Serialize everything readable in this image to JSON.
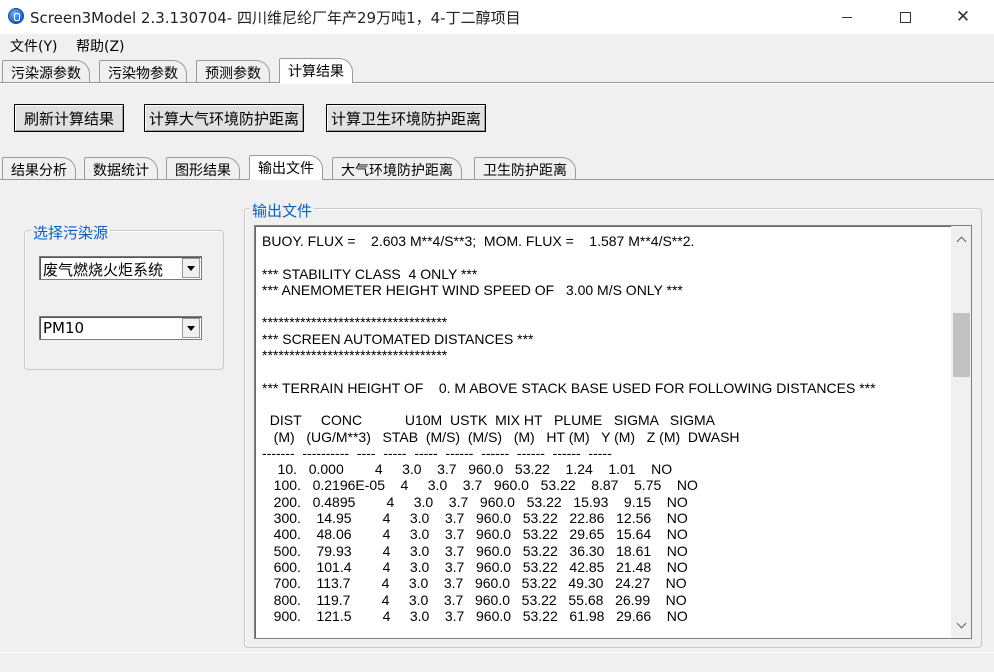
{
  "window": {
    "title": "Screen3Model 2.3.130704- 四川维尼纶厂年产29万吨1，4-丁二醇项目",
    "controls": {
      "minimize": "",
      "maximize": "",
      "close": "✕"
    }
  },
  "menu": {
    "file": "文件(Y)",
    "help": "帮助(Z)"
  },
  "top_tabs": [
    "污染源参数",
    "污染物参数",
    "预测参数",
    "计算结果"
  ],
  "top_tab_active": "计算结果",
  "buttons": {
    "refresh": "刷新计算结果",
    "air_distance": "计算大气环境防护距离",
    "health_distance": "计算卫生环境防护距离"
  },
  "sub_tabs": [
    "结果分析",
    "数据统计",
    "图形结果",
    "输出文件",
    "大气环境防护距离",
    "卫生防护距离"
  ],
  "sub_tab_active": "输出文件",
  "source_group": {
    "legend": "选择污染源",
    "source_select": "废气燃烧火炬系统",
    "pollutant_select": "PM10"
  },
  "output_group": {
    "legend": "输出文件",
    "lines": [
      "BUOY. FLUX =    2.603 M**4/S**3;  MOM. FLUX =    1.587 M**4/S**2.",
      "",
      "*** STABILITY CLASS  4 ONLY ***",
      "*** ANEMOMETER HEIGHT WIND SPEED OF   3.00 M/S ONLY ***",
      "",
      "**********************************",
      "*** SCREEN AUTOMATED DISTANCES ***",
      "**********************************",
      "",
      "*** TERRAIN HEIGHT OF    0. M ABOVE STACK BASE USED FOR FOLLOWING DISTANCES ***",
      "",
      "  DIST     CONC           U10M  USTK  MIX HT   PLUME   SIGMA   SIGMA",
      "   (M)   (UG/M**3)   STAB  (M/S)  (M/S)   (M)   HT (M)   Y (M)   Z (M)  DWASH",
      "-------  ----------  ----  -----  -----  ------  ------  ------  ------  -----",
      "    10.   0.000        4     3.0    3.7   960.0   53.22    1.24    1.01    NO",
      "   100.   0.2196E-05    4     3.0    3.7   960.0   53.22    8.87    5.75    NO",
      "   200.   0.4895        4     3.0    3.7   960.0   53.22   15.93    9.15    NO",
      "   300.    14.95        4     3.0    3.7   960.0   53.22   22.86   12.56    NO",
      "   400.    48.06        4     3.0    3.7   960.0   53.22   29.65   15.64    NO",
      "   500.    79.93        4     3.0    3.7   960.0   53.22   36.30   18.61    NO",
      "   600.    101.4        4     3.0    3.7   960.0   53.22   42.85   21.48    NO",
      "   700.    113.7        4     3.0    3.7   960.0   53.22   49.30   24.27    NO",
      "   800.    119.7        4     3.0    3.7   960.0   53.22   55.68   26.99    NO",
      "   900.    121.5        4     3.0    3.7   960.0   53.22   61.98   29.66    NO"
    ]
  }
}
